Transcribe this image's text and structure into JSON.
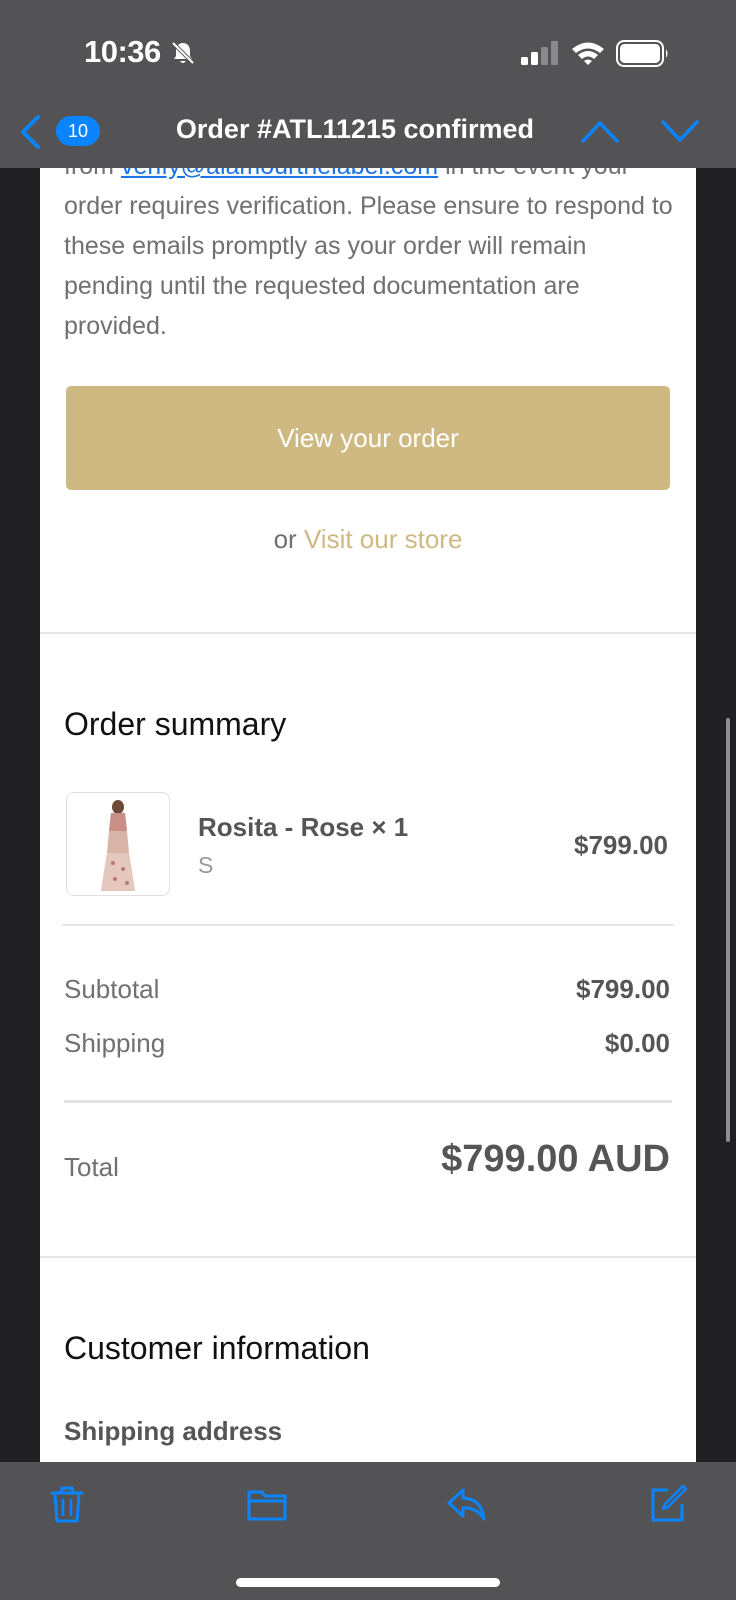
{
  "status_bar": {
    "time": "10:36",
    "icons": [
      "bell-slash-icon",
      "signal-icon",
      "wifi-icon",
      "battery-icon"
    ]
  },
  "nav": {
    "unread_count": "10",
    "title": "Order #ATL11215 confirmed",
    "icons": [
      "back-chevron-icon",
      "chevron-up-icon",
      "chevron-down-icon"
    ],
    "accent_color": "#0a84ff"
  },
  "email": {
    "intro_prefix": "from ",
    "verify_email": "verify@alamourthelabel.com",
    "intro_rest": " in the event your order requires verification. Please ensure to respond to these emails promptly as your order will remain pending until the requested documentation are provided.",
    "view_order_label": "View your order",
    "or_text": "or",
    "visit_store_label": "Visit our store",
    "brand_color": "#cfb982",
    "order_summary": {
      "title": "Order summary",
      "item": {
        "name": "Rosita - Rose × 1",
        "variant": "S",
        "price": "$799.00"
      },
      "subtotal_label": "Subtotal",
      "subtotal_value": "$799.00",
      "shipping_label": "Shipping",
      "shipping_value": "$0.00",
      "total_label": "Total",
      "total_value": "$799.00 AUD"
    },
    "customer_info": {
      "title": "Customer information",
      "shipping_address_label": "Shipping address"
    }
  },
  "toolbar": {
    "icons": [
      "trash-icon",
      "folder-icon",
      "reply-icon",
      "compose-icon"
    ]
  }
}
